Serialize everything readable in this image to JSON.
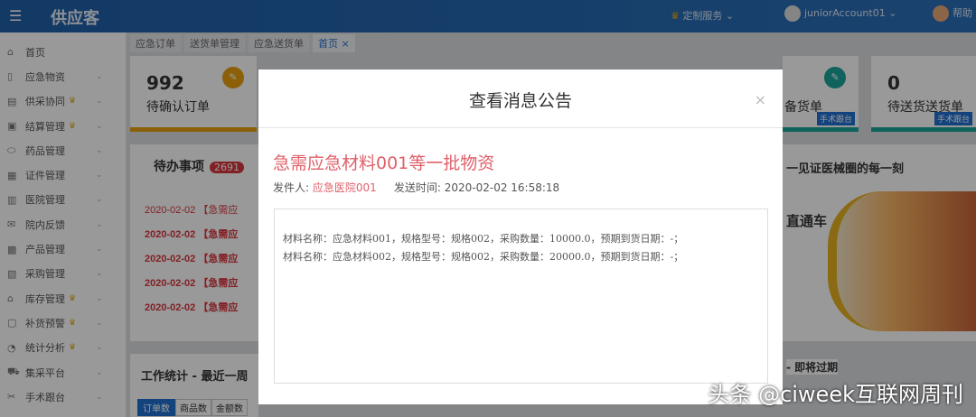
{
  "header": {
    "logo": "供应客",
    "service": "定制服务",
    "username": "juniorAccount01",
    "help": "帮助"
  },
  "sidebar": {
    "items": [
      {
        "label": "首页",
        "icon": "home-icon",
        "glyph": "⌂",
        "chev": false,
        "crown": false
      },
      {
        "label": "应急物资",
        "icon": "document-icon",
        "glyph": "▯",
        "chev": true,
        "crown": false
      },
      {
        "label": "供采协同",
        "icon": "clipboard-icon",
        "glyph": "▤",
        "chev": true,
        "crown": true
      },
      {
        "label": "结算管理",
        "icon": "settlement-icon",
        "glyph": "▣",
        "chev": true,
        "crown": true
      },
      {
        "label": "药品管理",
        "icon": "pill-icon",
        "glyph": "⬭",
        "chev": true,
        "crown": false
      },
      {
        "label": "证件管理",
        "icon": "certificate-icon",
        "glyph": "▦",
        "chev": true,
        "crown": false
      },
      {
        "label": "医院管理",
        "icon": "hospital-icon",
        "glyph": "▥",
        "chev": true,
        "crown": false
      },
      {
        "label": "院内反馈",
        "icon": "feedback-icon",
        "glyph": "✉",
        "chev": true,
        "crown": false
      },
      {
        "label": "产品管理",
        "icon": "product-icon",
        "glyph": "▩",
        "chev": true,
        "crown": false
      },
      {
        "label": "采购管理",
        "icon": "purchase-icon",
        "glyph": "▧",
        "chev": true,
        "crown": false
      },
      {
        "label": "库存管理",
        "icon": "warehouse-icon",
        "glyph": "⌂",
        "chev": true,
        "crown": true
      },
      {
        "label": "补货预警",
        "icon": "alert-box-icon",
        "glyph": "▢",
        "chev": true,
        "crown": true
      },
      {
        "label": "统计分析",
        "icon": "pie-chart-icon",
        "glyph": "◔",
        "chev": true,
        "crown": true
      },
      {
        "label": "集采平台",
        "icon": "cart-icon",
        "glyph": "⛟",
        "chev": true,
        "crown": false
      },
      {
        "label": "手术跟台",
        "icon": "scissors-icon",
        "glyph": "✂",
        "chev": true,
        "crown": false
      }
    ]
  },
  "tabs": [
    "应急订单",
    "送货单管理",
    "应急送货单",
    "首页"
  ],
  "cards": [
    {
      "num": "992",
      "label": "待确认订单"
    },
    {
      "num": "",
      "label": "备货单",
      "tag": "手术跟台"
    },
    {
      "num": "0",
      "label": "待送货送货单",
      "tag": "手术跟台"
    }
  ],
  "todo": {
    "title": "待办事项",
    "count": "2691",
    "rows": [
      "2020-02-02 【急需应",
      "2020-02-02 【急需应",
      "2020-02-02 【急需应",
      "2020-02-02 【急需应",
      "2020-02-02 【急需应"
    ]
  },
  "stats": {
    "title": "工作统计 - 最近一周",
    "tabs": [
      "订单数",
      "商品数",
      "金额数"
    ]
  },
  "news": {
    "title": "一见证医械圈的每一刻",
    "banner": "直通车",
    "expire": "- 即将过期"
  },
  "modal": {
    "title": "查看消息公告",
    "msg_title": "急需应急材料001等一批物资",
    "sender_label": "发件人:",
    "sender": "应急医院001",
    "time_label": "发送时间:",
    "time": "2020-02-02 16:58:18",
    "lines": [
      "材料名称：应急材料001，规格型号：规格002，采购数量：10000.0，预期到货日期：-；",
      "材料名称：应急材料002，规格型号：规格002，采购数量：20000.0，预期到货日期：-；"
    ]
  },
  "watermark": "头条 @ciweek互联网周刊"
}
